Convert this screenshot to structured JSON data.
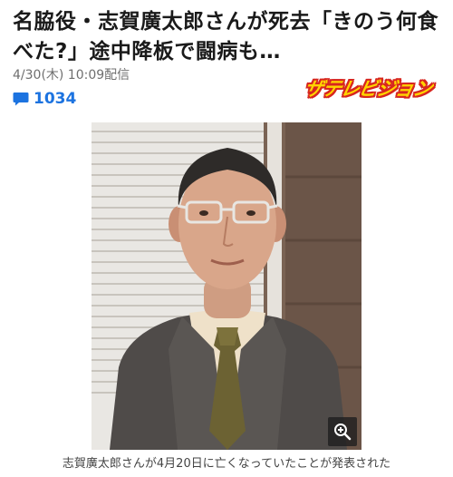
{
  "article": {
    "headline": "名脇役・志賀廣太郎さんが死去「きのう何食べた?」途中降板で闘病も…",
    "date": "4/30(木) 10:09配信",
    "comment_count": "1034",
    "publisher_logo": "ザテレビジョン",
    "photo_alt": "志賀廣太郎",
    "caption": "志賀廣太郎さんが4月20日に亡くなっていたことが発表された"
  },
  "icons": {
    "comments": "comment-bubble-icon",
    "zoom": "zoom-in-icon"
  },
  "colors": {
    "accent": "#1c73e0",
    "logo_fill": "#ffd400",
    "logo_outline": "#d7261f"
  }
}
